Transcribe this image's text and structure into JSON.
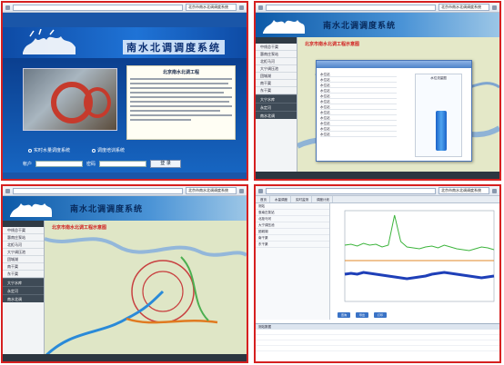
{
  "panel1": {
    "tab_label": "北京市南水北调调度系统",
    "title": "南水北调调度系统",
    "card_title": "北京南水北调工程",
    "radio_options": [
      "实时水量调度系统",
      "调度培训系统"
    ],
    "username_label": "帐户",
    "password_label": "密码",
    "login_label": "登 录"
  },
  "panel2": {
    "tab_label": "北京市南水北调调度系统",
    "title": "南水北调调度系统",
    "map_title": "北京市南水北调工程示意图",
    "sidebar_items": [
      "中线总干渠",
      "惠南庄泵站",
      "北拒马河",
      "大宁调压池",
      "团城湖",
      "南干渠",
      "东干渠",
      "大宁水库",
      "永定河",
      "南水北调"
    ],
    "gauge_label": "水位流量图",
    "table_rows": [
      "水位站",
      "水位站",
      "水位站",
      "水位站",
      "水位站",
      "水位站",
      "水位站",
      "水位站",
      "水位站",
      "水位站",
      "水位站",
      "水位站"
    ]
  },
  "panel3": {
    "tab_label": "北京市南水北调调度系统",
    "title": "南水北调调度系统",
    "map_title": "北京市南水北调工程示意图",
    "sidebar_items": [
      "中线总干渠",
      "惠南庄泵站",
      "北拒马河",
      "大宁调压池",
      "团城湖",
      "南干渠",
      "东干渠",
      "大宁水库",
      "永定河",
      "南水北调"
    ]
  },
  "panel4": {
    "tab_label": "北京市南水北调调度系统",
    "tabs": [
      "首页",
      "水量调度",
      "实时监测",
      "调度计划"
    ],
    "left_rows": [
      "测站",
      "惠南庄泵站",
      "北拒马河",
      "大宁调压池",
      "团城湖",
      "南干渠",
      "东干渠"
    ],
    "buttons": [
      "查询",
      "导出",
      "打印"
    ],
    "bottom_header": "测站数据"
  },
  "chart_data": {
    "type": "line",
    "title": "",
    "series": [
      {
        "values": [
          62,
          63,
          61,
          64,
          62,
          63,
          60,
          62,
          95,
          66,
          60,
          59,
          58,
          60,
          61,
          59,
          62,
          60,
          58,
          57,
          56,
          58,
          60,
          59,
          57
        ]
      },
      {
        "values": [
          45,
          45,
          45,
          45,
          45,
          45,
          45,
          45,
          45,
          45,
          45,
          45,
          45,
          45,
          45,
          45,
          45,
          45,
          45,
          45,
          45,
          45,
          45,
          45,
          45
        ]
      },
      {
        "values": [
          30,
          31,
          30,
          32,
          31,
          30,
          29,
          28,
          27,
          26,
          25,
          26,
          27,
          28,
          30,
          31,
          32,
          31,
          30,
          29,
          28,
          27,
          26,
          27,
          28
        ]
      }
    ],
    "ylim": [
      0,
      100
    ]
  },
  "colors": {
    "accent": "#1a56a8",
    "border": "#d62020",
    "series": [
      "#3cb43c",
      "#e08a2a",
      "#1e3fb8"
    ]
  }
}
